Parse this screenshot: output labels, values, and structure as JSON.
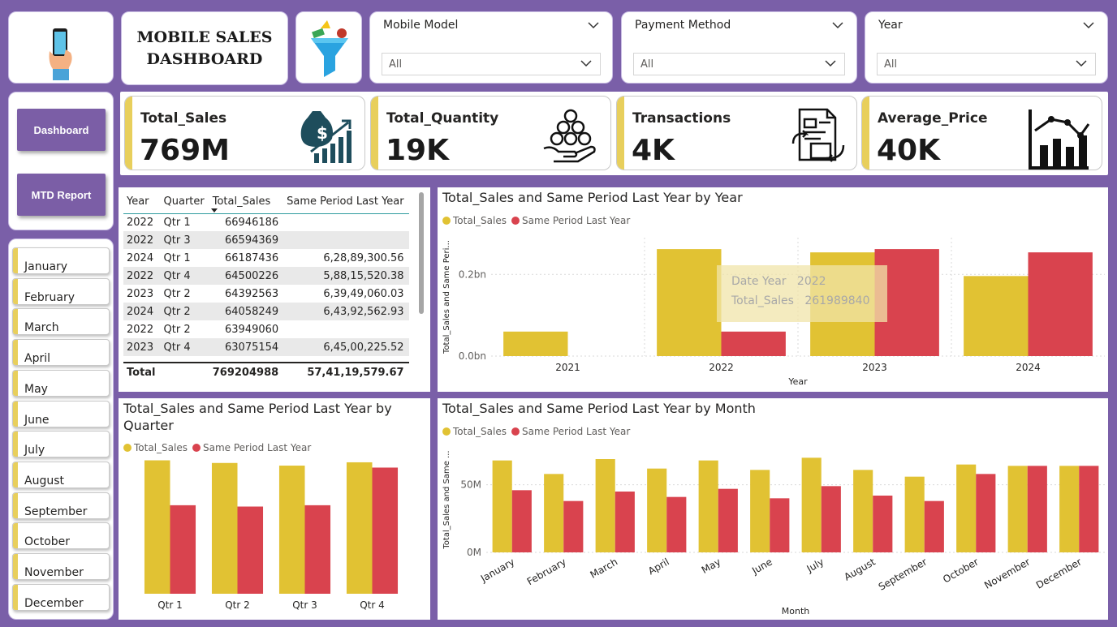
{
  "header": {
    "title_line1": "MOBILE SALES",
    "title_line2": "DASHBOARD"
  },
  "slicers": [
    {
      "label": "Mobile Model",
      "value": "All"
    },
    {
      "label": "Payment Method",
      "value": "All"
    },
    {
      "label": "Year",
      "value": "All"
    }
  ],
  "kpis": [
    {
      "name": "Total_Sales",
      "value": "769M",
      "icon": "money-bag-growth-icon"
    },
    {
      "name": "Total_Quantity",
      "value": "19K",
      "icon": "coins-hand-icon"
    },
    {
      "name": "Transactions",
      "value": "4K",
      "icon": "document-exchange-icon"
    },
    {
      "name": "Average_Price",
      "value": "40K",
      "icon": "bar-line-chart-icon"
    }
  ],
  "nav": {
    "dashboard": "Dashboard",
    "mtd": "MTD Report"
  },
  "months": [
    "January",
    "February",
    "March",
    "April",
    "May",
    "June",
    "July",
    "August",
    "September",
    "October",
    "November",
    "December"
  ],
  "colors": {
    "total_sales": "#e1c233",
    "same_period": "#d9434e",
    "accent": "#7b5ea6",
    "kpi_bar": "#e8cf5c"
  },
  "table": {
    "columns": [
      "Year",
      "Quarter",
      "Total_Sales",
      "Same Period Last Year"
    ],
    "rows": [
      [
        "2022",
        "Qtr 1",
        "66946186",
        ""
      ],
      [
        "2022",
        "Qtr 3",
        "66594369",
        ""
      ],
      [
        "2024",
        "Qtr 1",
        "66187436",
        "6,28,89,300.56"
      ],
      [
        "2022",
        "Qtr 4",
        "64500226",
        "5,88,15,520.38"
      ],
      [
        "2023",
        "Qtr 2",
        "64392563",
        "6,39,49,060.03"
      ],
      [
        "2024",
        "Qtr 2",
        "64058249",
        "6,43,92,562.93"
      ],
      [
        "2022",
        "Qtr 2",
        "63949060",
        ""
      ],
      [
        "2023",
        "Qtr 4",
        "63075154",
        "6,45,00,225.52"
      ]
    ],
    "total": {
      "label": "Total",
      "sales": "769204988",
      "spl": "57,41,19,579.67"
    }
  },
  "legend": {
    "total_sales": "Total_Sales",
    "same_period": "Same Period Last Year"
  },
  "tooltip": {
    "k1": "Date Year",
    "v1": "2022",
    "k2": "Total_Sales",
    "v2": "261989840"
  },
  "chart_data": [
    {
      "id": "by_year",
      "type": "bar",
      "title": "Total_Sales and Same Period Last Year by Year",
      "xlabel": "Year",
      "ylabel": "Total_Sales and Same Peri...",
      "categories": [
        "2021",
        "2022",
        "2023",
        "2024"
      ],
      "series": [
        {
          "name": "Total_Sales",
          "values": [
            60000000,
            261989840,
            254000000,
            196000000
          ]
        },
        {
          "name": "Same Period Last Year",
          "values": [
            0,
            60000000,
            262000000,
            254000000
          ]
        }
      ],
      "yticks": [
        {
          "v": 0,
          "label": "0.0bn"
        },
        {
          "v": 200000000,
          "label": "0.2bn"
        }
      ],
      "ylim": [
        0,
        290000000
      ]
    },
    {
      "id": "by_quarter",
      "type": "bar",
      "title": "Total_Sales and Same Period Last Year by Quarter",
      "categories": [
        "Qtr 1",
        "Qtr 2",
        "Qtr 3",
        "Qtr 4"
      ],
      "series": [
        {
          "name": "Total_Sales",
          "values": [
            202000000,
            198000000,
            194000000,
            199000000
          ]
        },
        {
          "name": "Same Period Last Year",
          "values": [
            134000000,
            132000000,
            134000000,
            191000000
          ]
        }
      ],
      "ylim": [
        0,
        210000000
      ]
    },
    {
      "id": "by_month",
      "type": "bar",
      "title": "Total_Sales and Same Period Last Year by Month",
      "xlabel": "Month",
      "ylabel": "Total_Sales and Same ...",
      "categories": [
        "January",
        "February",
        "March",
        "April",
        "May",
        "June",
        "July",
        "August",
        "September",
        "October",
        "November",
        "December"
      ],
      "series": [
        {
          "name": "Total_Sales",
          "values": [
            68000000,
            58000000,
            69000000,
            62000000,
            68000000,
            61000000,
            70000000,
            61000000,
            56000000,
            65000000,
            64000000,
            64000000
          ]
        },
        {
          "name": "Same Period Last Year",
          "values": [
            46000000,
            38000000,
            45000000,
            41000000,
            47000000,
            40000000,
            49000000,
            42000000,
            38000000,
            58000000,
            64000000,
            64000000
          ]
        }
      ],
      "yticks": [
        {
          "v": 0,
          "label": "0M"
        },
        {
          "v": 50000000,
          "label": "50M"
        }
      ],
      "ylim": [
        0,
        78000000
      ]
    }
  ]
}
